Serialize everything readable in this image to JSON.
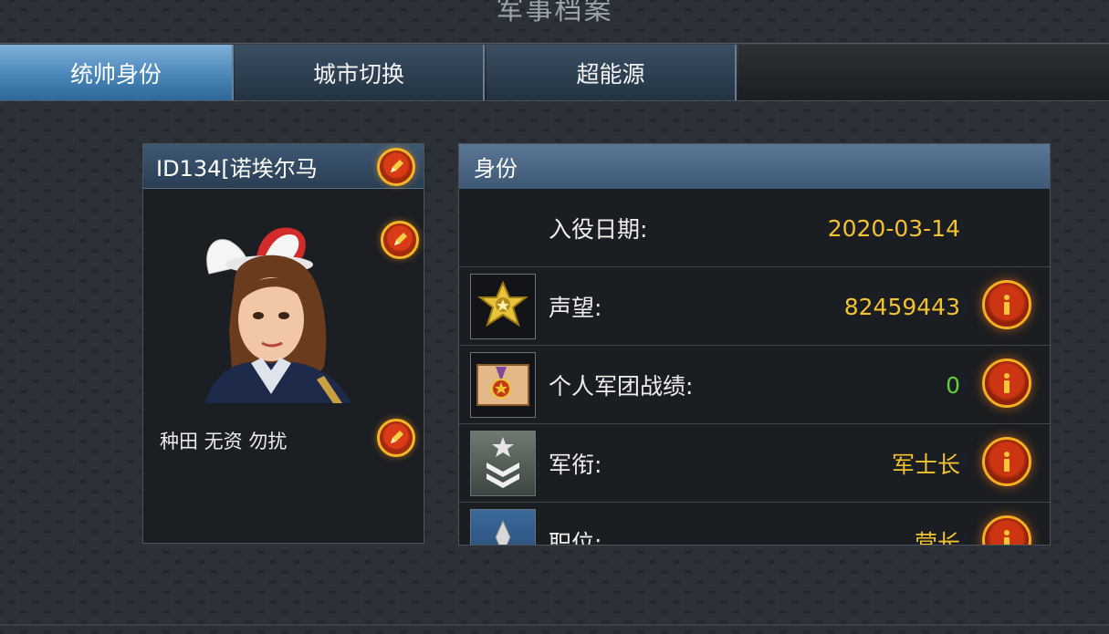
{
  "window": {
    "title": "军事档案"
  },
  "tabs": [
    {
      "label": "统帅身份",
      "active": true
    },
    {
      "label": "城市切换",
      "active": false
    },
    {
      "label": "超能源",
      "active": false
    }
  ],
  "profile": {
    "name": "ID134[诺埃尔马",
    "signature": "种田 无资 勿扰"
  },
  "identity": {
    "title": "身份",
    "enlist": {
      "label": "入役日期:",
      "value": "2020-03-14"
    },
    "rows": [
      {
        "label": "声望:",
        "value": "82459443",
        "value_color": "#f2c230",
        "icon": "gold-star-badge-icon"
      },
      {
        "label": "个人军团战绩:",
        "value": "0",
        "value_color": "#5fd33a",
        "icon": "medal-certificate-icon"
      },
      {
        "label": "军衔:",
        "value": "军士长",
        "value_color": "#f2c230",
        "icon": "rank-chevron-icon"
      },
      {
        "label": "职位:",
        "value": "营长",
        "value_color": "#f2c230",
        "icon": "position-badge-icon"
      }
    ]
  },
  "colors": {
    "accent_gold": "#f2c230",
    "positive_green": "#5fd33a",
    "tab_active": "#4a86b9"
  }
}
